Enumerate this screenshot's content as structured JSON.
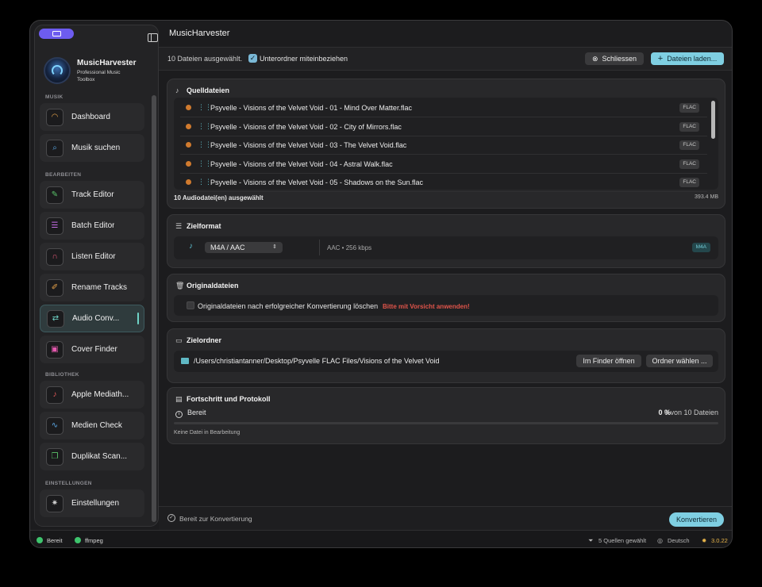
{
  "window": {
    "title": "MusicHarvester"
  },
  "sidebar": {
    "app_name": "MusicHarvester",
    "app_subtitle": "Professional Music Toolbox",
    "sections": {
      "musik": "MUSIK",
      "bearbeiten": "BEARBEITEN",
      "bibliothek": "BIBLIOTHEK",
      "einstellungen": "EINSTELLUNGEN"
    },
    "items": [
      {
        "label": "Dashboard",
        "icon": "gauge-icon",
        "color": "#e8a34a"
      },
      {
        "label": "Musik suchen",
        "icon": "search-icon",
        "color": "#5aa8e6"
      },
      {
        "label": "Track Editor",
        "icon": "edit-icon",
        "color": "#5bc46a"
      },
      {
        "label": "Batch Editor",
        "icon": "list-icon",
        "color": "#c46be6"
      },
      {
        "label": "Listen Editor",
        "icon": "headphones-icon",
        "color": "#e65a7a"
      },
      {
        "label": "Rename Tracks",
        "icon": "pencil-icon",
        "color": "#e8a34a"
      },
      {
        "label": "Audio Conv...",
        "icon": "convert-icon",
        "color": "#6fd3c6",
        "active": true
      },
      {
        "label": "Cover Finder",
        "icon": "image-icon",
        "color": "#e65ab0"
      },
      {
        "label": "Apple Mediath...",
        "icon": "music-note-icon",
        "color": "#e65a5a"
      },
      {
        "label": "Medien Check",
        "icon": "waveform-icon",
        "color": "#5aa8e6"
      },
      {
        "label": "Duplikat Scan...",
        "icon": "duplicate-icon",
        "color": "#5bc46a"
      },
      {
        "label": "Einstellungen",
        "icon": "gear-icon",
        "color": "#cfcfcf"
      }
    ]
  },
  "toolbar": {
    "selection": "10 Dateien ausgewählt.",
    "subfolder_label": "Unterordner miteinbeziehen",
    "subfolder_checked": true,
    "close_label": "Schliessen",
    "load_label": "Dateien laden..."
  },
  "source": {
    "title": "Quelldateien",
    "files": [
      {
        "name": "Psyvelle - Visions of the Velvet Void - 01 - Mind Over Matter.flac",
        "tag": "FLAC"
      },
      {
        "name": "Psyvelle - Visions of the Velvet Void - 02 - City of Mirrors.flac",
        "tag": "FLAC"
      },
      {
        "name": "Psyvelle - Visions of the Velvet Void - 03 - The Velvet Void.flac",
        "tag": "FLAC"
      },
      {
        "name": "Psyvelle - Visions of the Velvet Void - 04 - Astral Walk.flac",
        "tag": "FLAC"
      },
      {
        "name": "Psyvelle - Visions of the Velvet Void - 05 - Shadows on the Sun.flac",
        "tag": "FLAC"
      }
    ],
    "footer": "10 Audiodatei(en) ausgewählt",
    "size": "393.4 MB"
  },
  "format": {
    "title": "Zielformat",
    "selected": "M4A / AAC",
    "info": "AAC • 256 kbps",
    "tag": "M4A"
  },
  "originals": {
    "title": "Originaldateien",
    "checkbox_label": "Originaldateien nach erfolgreicher Konvertierung löschen",
    "checked": false,
    "warning": "Bitte mit Vorsicht anwenden!"
  },
  "target": {
    "title": "Zielordner",
    "path": "/Users/christiantanner/Desktop/Psyvelle FLAC Files/Visions of the Velvet Void",
    "finder_label": "Im Finder öffnen",
    "choose_label": "Ordner wählen ..."
  },
  "progress": {
    "title": "Fortschritt und Protokoll",
    "status": "Bereit",
    "percent_label": "0 %",
    "count_label": "0 von 10 Dateien",
    "fraction": 0,
    "note": "Keine Datei in Bearbeitung"
  },
  "bottom": {
    "status": "Bereit zur Konvertierung",
    "convert_label": "Konvertieren"
  },
  "statusbar": {
    "ready": "Bereit",
    "ffmpeg": "ffmpeg",
    "sources": "5 Quellen gewählt",
    "language": "Deutsch",
    "version": "3.0.22"
  }
}
